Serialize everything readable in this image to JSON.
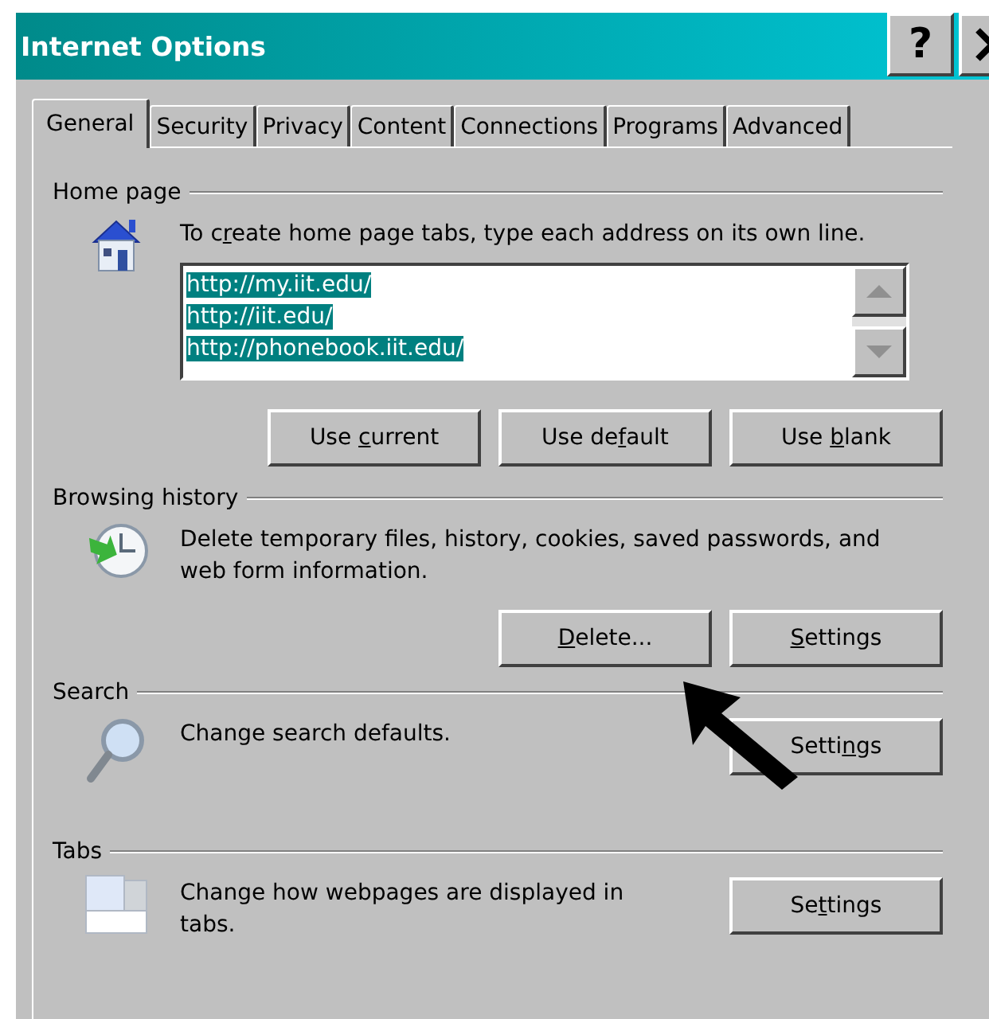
{
  "window": {
    "title": "Internet Options",
    "help_button": "?"
  },
  "tabs": [
    {
      "label": "General",
      "selected": true
    },
    {
      "label": "Security",
      "selected": false
    },
    {
      "label": "Privacy",
      "selected": false
    },
    {
      "label": "Content",
      "selected": false
    },
    {
      "label": "Connections",
      "selected": false
    },
    {
      "label": "Programs",
      "selected": false
    },
    {
      "label": "Advanced",
      "selected": false
    }
  ],
  "sections": [
    {
      "kind": "home_page",
      "title": "Home page",
      "description": {
        "pre": "To c",
        "key": "r",
        "post": "eate home page tabs, type each address on its own line."
      },
      "addresses": [
        {
          "text": "http://my.iit.edu/",
          "selected": true
        },
        {
          "text": "http://iit.edu/",
          "selected": true
        },
        {
          "text": "http://phonebook.iit.edu/",
          "selected": true
        }
      ],
      "buttons": [
        {
          "pre": "Use ",
          "key": "c",
          "post": "urrent"
        },
        {
          "pre": "Use de",
          "key": "f",
          "post": "ault"
        },
        {
          "pre": "Use ",
          "key": "b",
          "post": "lank"
        }
      ]
    },
    {
      "kind": "history",
      "title": "Browsing history",
      "description": {
        "pre": "Delete temporary files, history, cookies, saved passwords, and web form information."
      },
      "buttons": [
        {
          "key": "D",
          "post": "elete..."
        },
        {
          "key": "S",
          "post": "ettings"
        }
      ]
    },
    {
      "kind": "search",
      "title": "Search",
      "description": {
        "pre": "Change search defaults."
      },
      "buttons": [
        {
          "pre": "Setti",
          "key": "n",
          "post": "gs"
        }
      ]
    },
    {
      "kind": "tabs",
      "title": "Tabs",
      "description": {
        "pre": "Change how webpages are displayed in tabs."
      },
      "buttons": [
        {
          "pre": "Se",
          "key": "t",
          "post": "tings"
        }
      ]
    }
  ]
}
